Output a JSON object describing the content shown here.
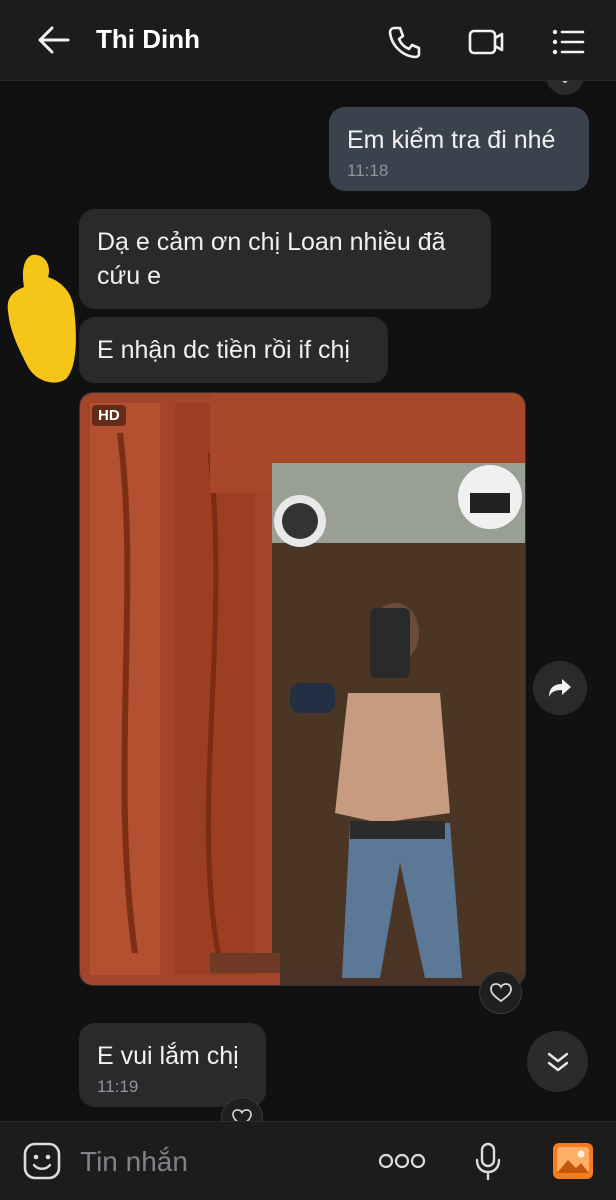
{
  "header": {
    "contact_name": "Thi Dinh",
    "icons": [
      "back-arrow-icon",
      "phone-icon",
      "video-call-icon",
      "menu-list-icon"
    ]
  },
  "messages": [
    {
      "direction": "outgoing",
      "text": "Em kiểm tra đi nhé",
      "time": "11:18"
    },
    {
      "direction": "incoming",
      "text": "Dạ e cảm ơn chị Loan nhiều đã cứu e"
    },
    {
      "direction": "incoming",
      "text": "E nhận dc tiền rồi if chị"
    },
    {
      "direction": "incoming",
      "type": "photo",
      "badge": "HD"
    },
    {
      "direction": "incoming",
      "text": "E vui lắm chị",
      "time": "11:19"
    }
  ],
  "composer": {
    "placeholder": "Tin nhắn",
    "icons": [
      "sticker-icon",
      "more-icon",
      "microphone-icon",
      "gallery-icon"
    ]
  },
  "colors": {
    "background": "#111112",
    "incoming_bubble": "#2a2a2c",
    "outgoing_bubble": "#3a424d",
    "gallery_accent": "#f57c1f",
    "highlight": "#f5c518"
  }
}
